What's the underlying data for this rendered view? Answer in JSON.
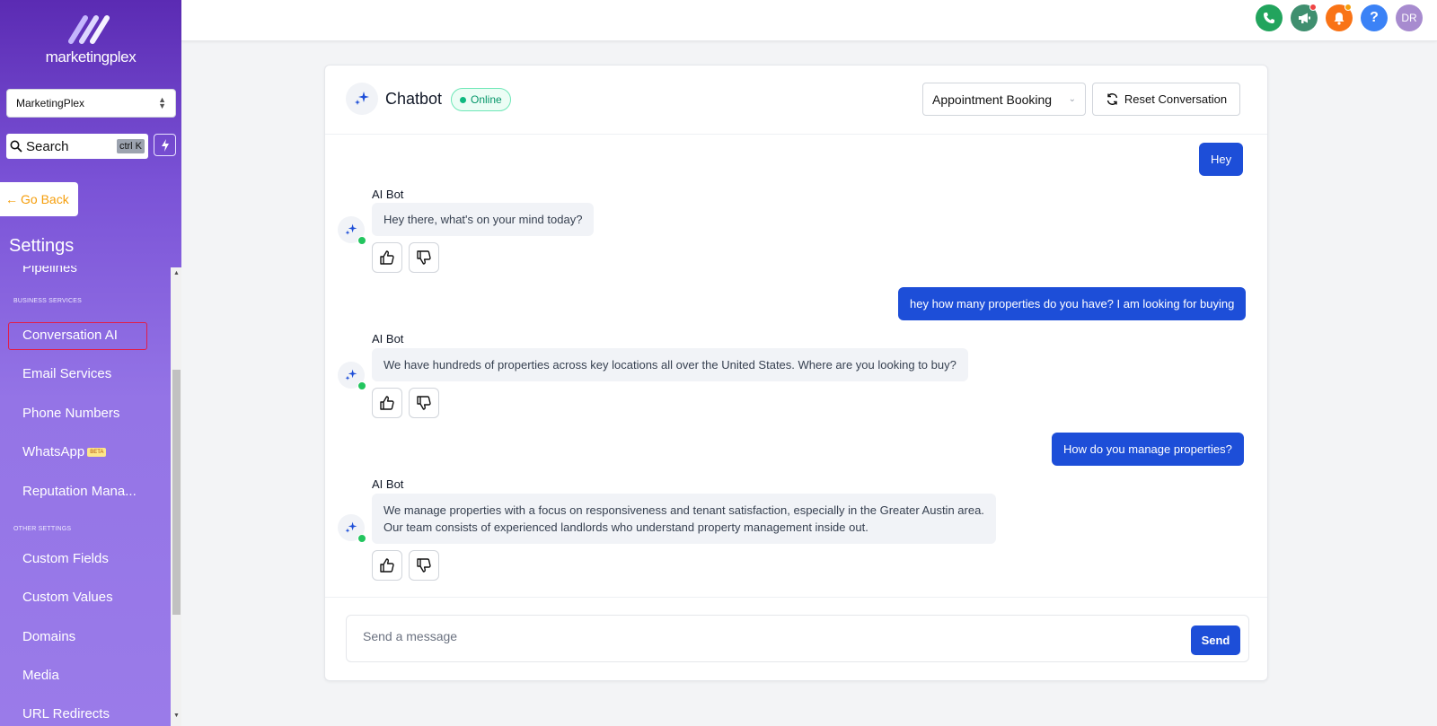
{
  "brand": {
    "name": "marketingplex"
  },
  "account_selector": {
    "value": "MarketingPlex"
  },
  "search": {
    "placeholder": "Search",
    "shortcut": "ctrl K"
  },
  "go_back": {
    "label": "Go Back"
  },
  "settings": {
    "title": "Settings",
    "items": {
      "pipelines": "Pipelines",
      "section_business": "BUSINESS SERVICES",
      "conversation_ai": "Conversation AI",
      "email_services": "Email Services",
      "phone_numbers": "Phone Numbers",
      "whatsapp": "WhatsApp",
      "whatsapp_badge": "BETA",
      "reputation": "Reputation Mana...",
      "section_other": "OTHER SETTINGS",
      "custom_fields": "Custom Fields",
      "custom_values": "Custom Values",
      "domains": "Domains",
      "media": "Media",
      "url_redirects": "URL Redirects"
    },
    "active_item": "Conversation AI"
  },
  "topbar": {
    "icons": [
      "phone-icon",
      "megaphone-icon",
      "bell-icon",
      "help-icon"
    ],
    "avatar_initials": "DR",
    "colors": {
      "phone": "#22a45d",
      "megaphone": "#3f8f6f",
      "bell": "#f97316",
      "help": "#3b82f6",
      "avatar": "#a78bcf"
    }
  },
  "chat": {
    "title": "Chatbot",
    "status": "Online",
    "flow_select": "Appointment Booking",
    "reset_label": "Reset Conversation",
    "bot_name": "AI Bot",
    "messages": [
      {
        "from": "user",
        "text": "Hey"
      },
      {
        "from": "bot",
        "text": "Hey there, what's on your mind today?"
      },
      {
        "from": "user",
        "text": "hey how many properties do you have? I am looking for buying"
      },
      {
        "from": "bot",
        "text": "We have hundreds of properties across key locations all over the United States. Where are you looking to buy?"
      },
      {
        "from": "user",
        "text": "How do you manage properties?"
      },
      {
        "from": "bot",
        "lines": [
          "We manage properties with a focus on responsiveness and tenant satisfaction, especially in the Greater Austin area.",
          "Our team consists of experienced landlords who understand property management inside out."
        ]
      }
    ],
    "composer_placeholder": "Send a message",
    "send_label": "Send"
  },
  "colors": {
    "primary": "#1d4ed8",
    "online": "#10b981",
    "highlight": "#e11d48",
    "goback": "#f59e0b"
  }
}
